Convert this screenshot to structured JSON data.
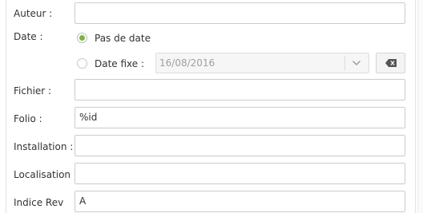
{
  "form": {
    "author": {
      "label": "Auteur :",
      "value": ""
    },
    "date": {
      "label": "Date :",
      "options": [
        {
          "label": "Pas de date",
          "checked": true
        },
        {
          "label": "Date fixe :",
          "checked": false
        }
      ],
      "fixed_date_value": "16/08/2016",
      "dropdown_icon": "chevron-down-icon",
      "clear_icon": "backspace-icon"
    },
    "file": {
      "label": "Fichier :",
      "value": ""
    },
    "folio": {
      "label": "Folio :",
      "value": "%id"
    },
    "installation": {
      "label": "Installation :",
      "value": ""
    },
    "location": {
      "label": "Localisation",
      "value": ""
    },
    "revision": {
      "label": "Indice Rev",
      "value": "A"
    }
  },
  "colors": {
    "radio_checked": "#7cb342",
    "input_border": "#cccccc",
    "disabled_text": "#a0a0a0"
  }
}
